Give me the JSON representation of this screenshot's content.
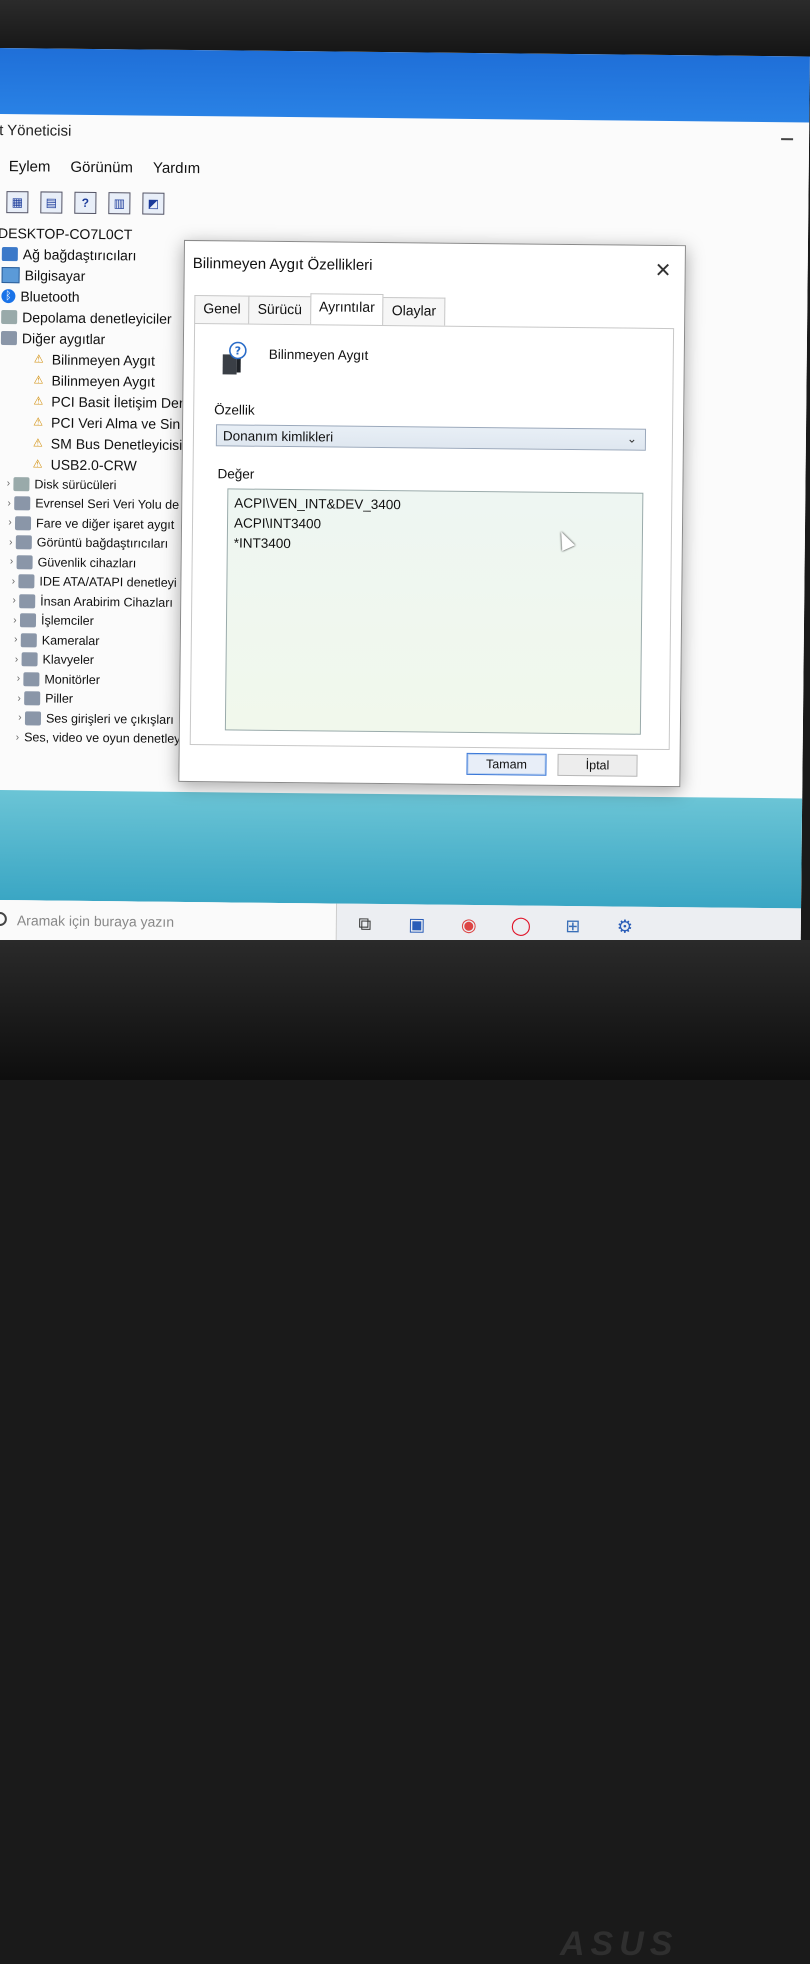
{
  "window": {
    "title": "t Yöneticisi",
    "menu": [
      "Eylem",
      "Görünüm",
      "Yardım"
    ]
  },
  "tree": {
    "root": "DESKTOP-CO7L0CT",
    "items": [
      {
        "label": "Ağ bağdaştırıcıları",
        "icon": "network-icon",
        "indent": 0,
        "chevron": ""
      },
      {
        "label": "Bilgisayar",
        "icon": "computer-icon",
        "indent": 0,
        "chevron": ""
      },
      {
        "label": "Bluetooth",
        "icon": "bluetooth-icon",
        "indent": 0,
        "chevron": ""
      },
      {
        "label": "Depolama denetleyiciler",
        "icon": "storage-icon",
        "indent": 0,
        "chevron": ""
      },
      {
        "label": "Diğer aygıtlar",
        "icon": "other-devices-icon",
        "indent": 0,
        "chevron": ""
      },
      {
        "label": "Bilinmeyen Aygıt",
        "icon": "warning-icon",
        "indent": 1,
        "chevron": ""
      },
      {
        "label": "Bilinmeyen Aygıt",
        "icon": "warning-icon",
        "indent": 1,
        "chevron": ""
      },
      {
        "label": "PCI Basit İletişim Der",
        "icon": "warning-icon",
        "indent": 1,
        "chevron": ""
      },
      {
        "label": "PCI Veri Alma ve Sin",
        "icon": "warning-icon",
        "indent": 1,
        "chevron": ""
      },
      {
        "label": "SM Bus Denetleyicisi",
        "icon": "warning-icon",
        "indent": 1,
        "chevron": ""
      },
      {
        "label": "USB2.0-CRW",
        "icon": "warning-icon",
        "indent": 1,
        "chevron": ""
      },
      {
        "label": "Disk sürücüleri",
        "icon": "disk-icon",
        "indent": 0,
        "chevron": "›"
      },
      {
        "label": "Evrensel Seri Veri Yolu de",
        "icon": "usb-icon",
        "indent": 0,
        "chevron": "›"
      },
      {
        "label": "Fare ve diğer işaret aygıt",
        "icon": "mouse-icon",
        "indent": 0,
        "chevron": "›"
      },
      {
        "label": "Görüntü bağdaştırıcıları",
        "icon": "display-icon",
        "indent": 0,
        "chevron": "›"
      },
      {
        "label": "Güvenlik cihazları",
        "icon": "security-icon",
        "indent": 0,
        "chevron": "›"
      },
      {
        "label": "IDE ATA/ATAPI denetleyi",
        "icon": "ide-icon",
        "indent": 0,
        "chevron": "›"
      },
      {
        "label": "İnsan Arabirim Cihazları",
        "icon": "hid-icon",
        "indent": 0,
        "chevron": "›"
      },
      {
        "label": "İşlemciler",
        "icon": "cpu-icon",
        "indent": 0,
        "chevron": "›"
      },
      {
        "label": "Kameralar",
        "icon": "camera-icon",
        "indent": 0,
        "chevron": "›"
      },
      {
        "label": "Klavyeler",
        "icon": "keyboard-icon",
        "indent": 0,
        "chevron": "›"
      },
      {
        "label": "Monitörler",
        "icon": "monitor-icon",
        "indent": 0,
        "chevron": "›"
      },
      {
        "label": "Piller",
        "icon": "battery-icon",
        "indent": 0,
        "chevron": "›"
      },
      {
        "label": "Ses girişleri ve çıkışları",
        "icon": "audio-icon",
        "indent": 0,
        "chevron": "›"
      },
      {
        "label": "Ses, video ve oyun denetleyicileri",
        "icon": "sound-icon",
        "indent": 0,
        "chevron": "›"
      }
    ]
  },
  "dialog": {
    "title": "Bilinmeyen Aygıt Özellikleri",
    "tabs": [
      "Genel",
      "Sürücü",
      "Ayrıntılar",
      "Olaylar"
    ],
    "active_tab": "Ayrıntılar",
    "device_name": "Bilinmeyen Aygıt",
    "property_label": "Özellik",
    "property_value": "Donanım kimlikleri",
    "value_label": "Değer",
    "values": [
      "ACPI\\VEN_INT&DEV_3400",
      "ACPI\\INT3400",
      "*INT3400"
    ],
    "ok_label": "Tamam",
    "cancel_label": "İptal"
  },
  "taskbar": {
    "search_placeholder": "Aramak için buraya yazın"
  },
  "colors": {
    "accent": "#3b78d8",
    "warning": "#d08a00",
    "desktop_top": "#2a83e6",
    "desktop_bottom": "#3aa6c4"
  }
}
